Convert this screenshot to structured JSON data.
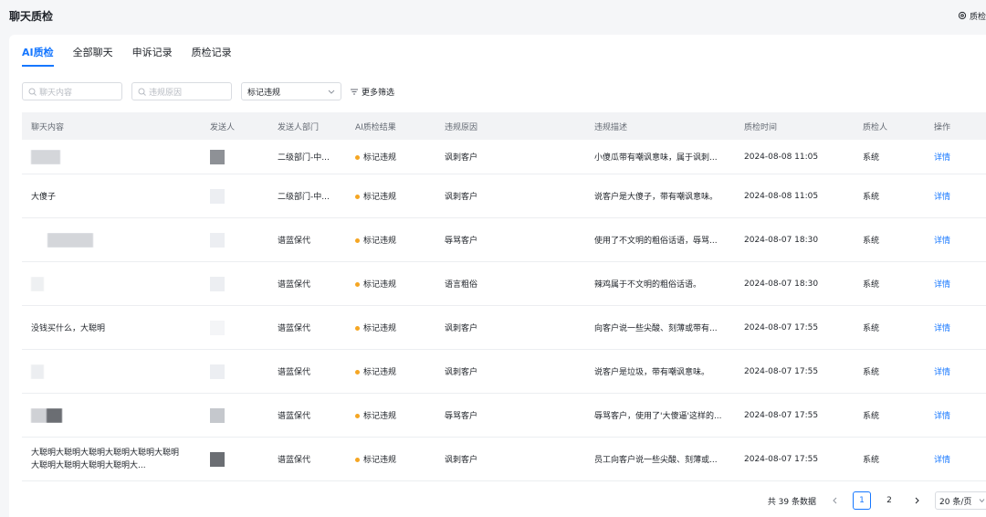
{
  "page": {
    "title": "聊天质检",
    "settings_label": "质检"
  },
  "tabs": [
    {
      "label": "AI质检",
      "active": true
    },
    {
      "label": "全部聊天",
      "active": false
    },
    {
      "label": "申诉记录",
      "active": false
    },
    {
      "label": "质检记录",
      "active": false
    }
  ],
  "filters": {
    "chat_placeholder": "聊天内容",
    "reason_placeholder": "违规原因",
    "status_value": "标记违规",
    "more_label": "更多筛选"
  },
  "columns": [
    "聊天内容",
    "发送人",
    "发送人部门",
    "AI质检结果",
    "违规原因",
    "违规描述",
    "质检时间",
    "质检人",
    "操作"
  ],
  "rows": [
    {
      "content": "",
      "content_kind": "image",
      "dept": "二级部门-中...",
      "result": "标记违规",
      "reason": "讽刺客户",
      "desc": "小傻瓜带有嘲讽意味，属于讽刺...",
      "time": "2024-08-08 11:05",
      "checker": "系统",
      "action": "详情"
    },
    {
      "content": "大傻子",
      "content_kind": "text",
      "dept": "二级部门-中...",
      "result": "标记违规",
      "reason": "讽刺客户",
      "desc": "说客户是大傻子，带有嘲讽意味。",
      "time": "2024-08-08 11:05",
      "checker": "系统",
      "action": "详情"
    },
    {
      "content": "",
      "content_kind": "image",
      "dept": "谱蓝保代",
      "result": "标记违规",
      "reason": "辱骂客户",
      "desc": "使用了不文明的粗俗话语，辱骂...",
      "time": "2024-08-07 18:30",
      "checker": "系统",
      "action": "详情"
    },
    {
      "content": "",
      "content_kind": "image",
      "dept": "谱蓝保代",
      "result": "标记违规",
      "reason": "语言粗俗",
      "desc": "辣鸡属于不文明的粗俗话语。",
      "time": "2024-08-07 18:30",
      "checker": "系统",
      "action": "详情"
    },
    {
      "content": "没钱买什么，大聪明",
      "content_kind": "text",
      "dept": "谱蓝保代",
      "result": "标记违规",
      "reason": "讽刺客户",
      "desc": "向客户说一些尖酸、刻薄或带有...",
      "time": "2024-08-07 17:55",
      "checker": "系统",
      "action": "详情"
    },
    {
      "content": "",
      "content_kind": "image",
      "dept": "谱蓝保代",
      "result": "标记违规",
      "reason": "讽刺客户",
      "desc": "说客户是垃圾，带有嘲讽意味。",
      "time": "2024-08-07 17:55",
      "checker": "系统",
      "action": "详情"
    },
    {
      "content": "",
      "content_kind": "image",
      "dept": "谱蓝保代",
      "result": "标记违规",
      "reason": "辱骂客户",
      "desc": "辱骂客户，使用了'大傻逼'这样的...",
      "time": "2024-08-07 17:55",
      "checker": "系统",
      "action": "详情"
    },
    {
      "content": "大聪明大聪明大聪明大聪明大聪明大聪明大聪明大聪明大聪明大聪明大...",
      "content_kind": "text",
      "dept": "谱蓝保代",
      "result": "标记违规",
      "reason": "讽刺客户",
      "desc": "员工向客户说一些尖酸、刻薄或...",
      "time": "2024-08-07 17:55",
      "checker": "系统",
      "action": "详情"
    }
  ],
  "pagination": {
    "total_label": "共 39 条数据",
    "pages": [
      "1",
      "2"
    ],
    "current": "1",
    "page_size": "20 条/页"
  },
  "colors": {
    "accent": "#1677ff",
    "warning_dot": "#f5a623"
  }
}
